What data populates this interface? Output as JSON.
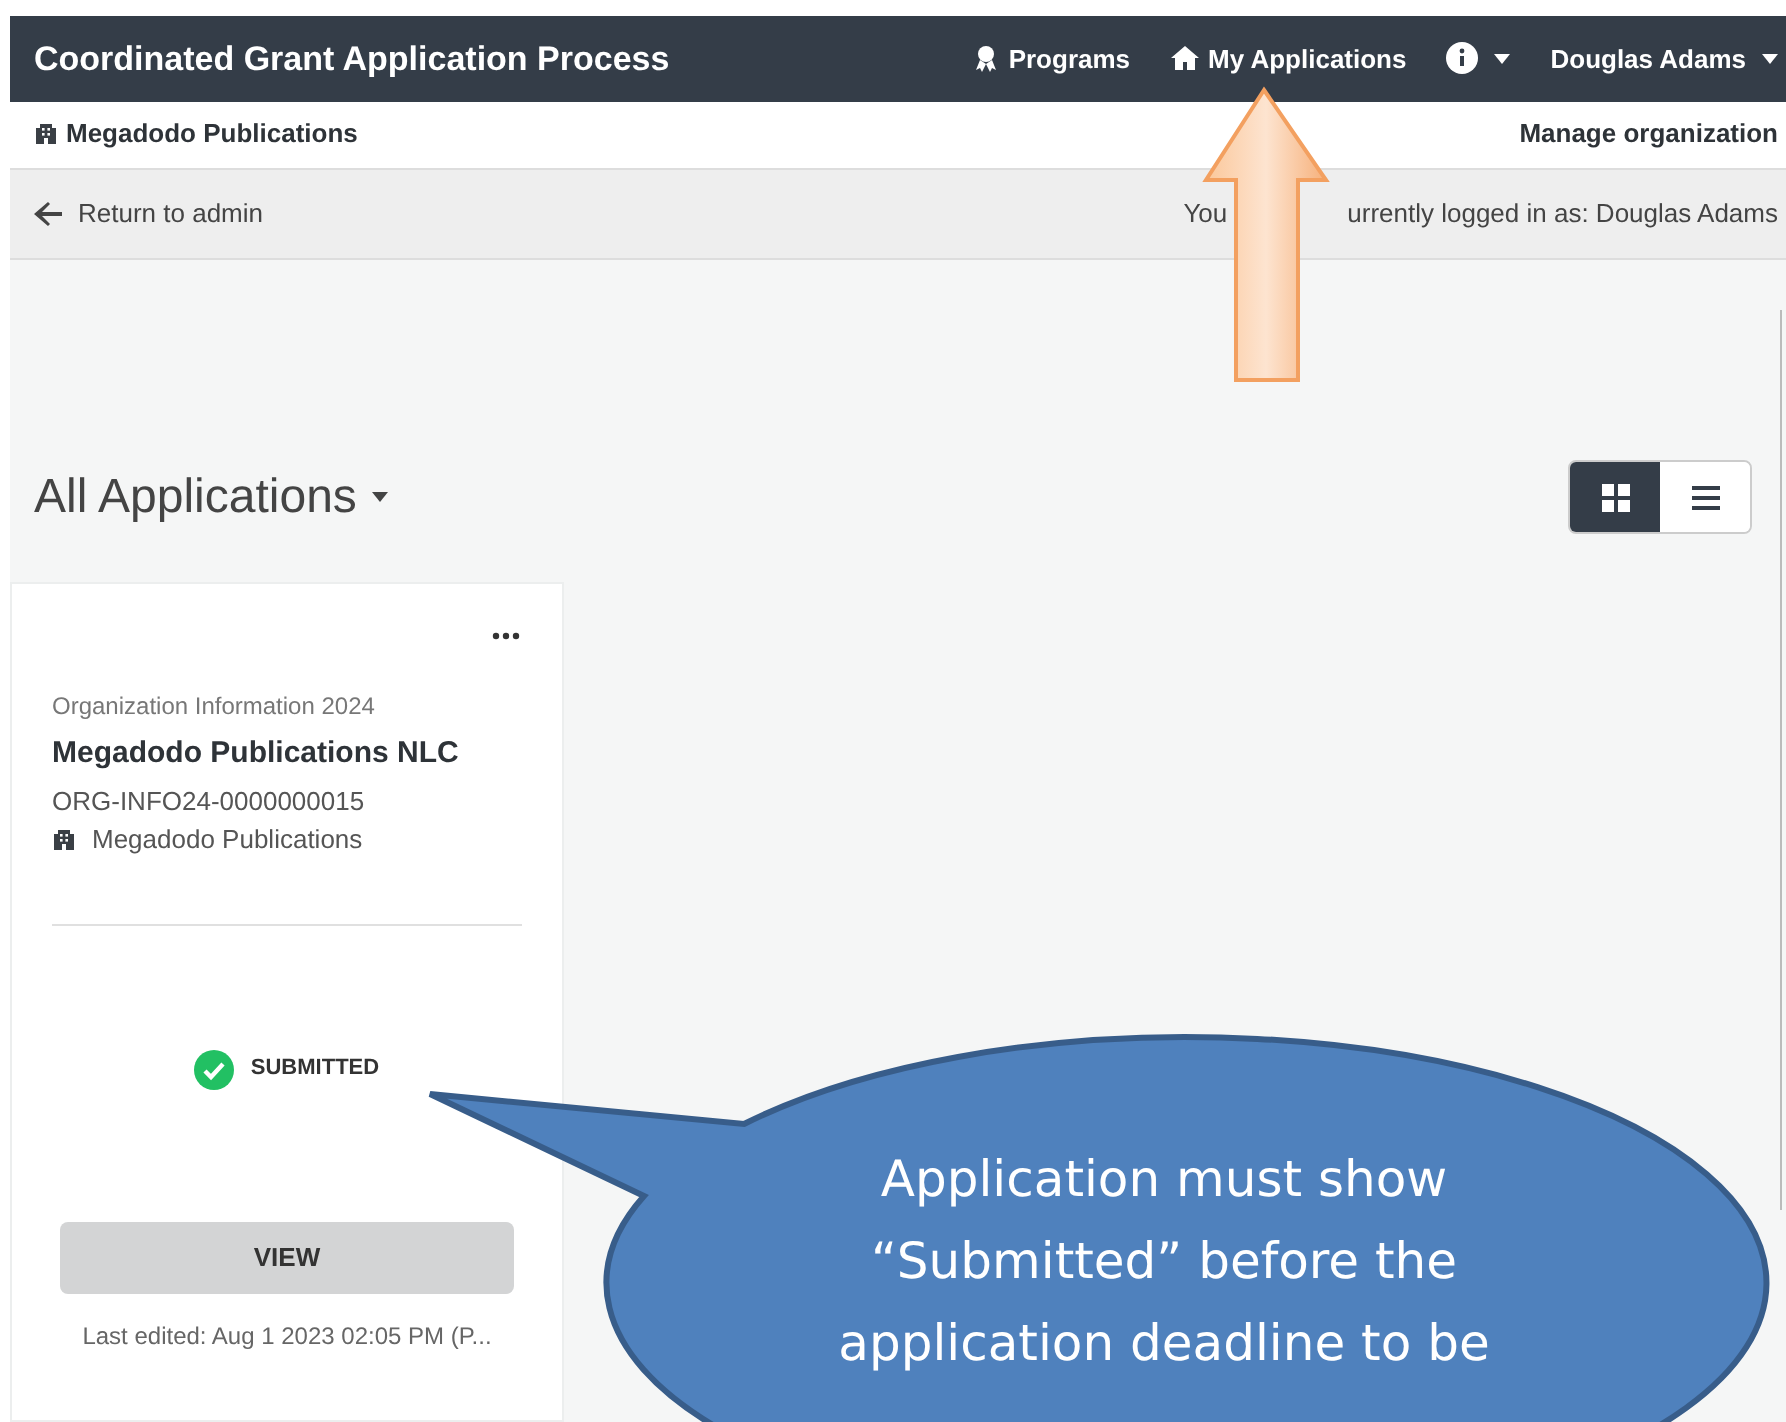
{
  "navbar": {
    "title": "Coordinated Grant Application Process",
    "links": [
      {
        "kind": "programs",
        "label": "Programs"
      },
      {
        "kind": "home",
        "label": "My Applications"
      },
      {
        "kind": "info"
      }
    ],
    "user": "Douglas Adams"
  },
  "org_bar": {
    "organization": "Megadodo Publications",
    "manage": "Manage organization"
  },
  "admin_bar": {
    "return": "Return to admin",
    "logged_in_visible_parts": [
      "You",
      "urrently logged in as: Douglas Adams"
    ]
  },
  "main": {
    "title": "All Applications",
    "view_toggle": [
      {
        "kind": "grid",
        "selected": true
      },
      {
        "kind": "list",
        "selected": false
      }
    ],
    "cards": [
      {
        "program": "Organization Information 2024",
        "name": "Megadodo Publications NLC",
        "id": "ORG-INFO24-0000000015",
        "organization": "Megadodo Publications",
        "status": "SUBMITTED",
        "button": "VIEW",
        "last_edited": "Last edited: Aug 1 2023 02:05 PM (P..."
      }
    ]
  },
  "callout": {
    "lines": [
      "Application must show",
      "“Submitted” before the",
      "application deadline to be"
    ]
  }
}
